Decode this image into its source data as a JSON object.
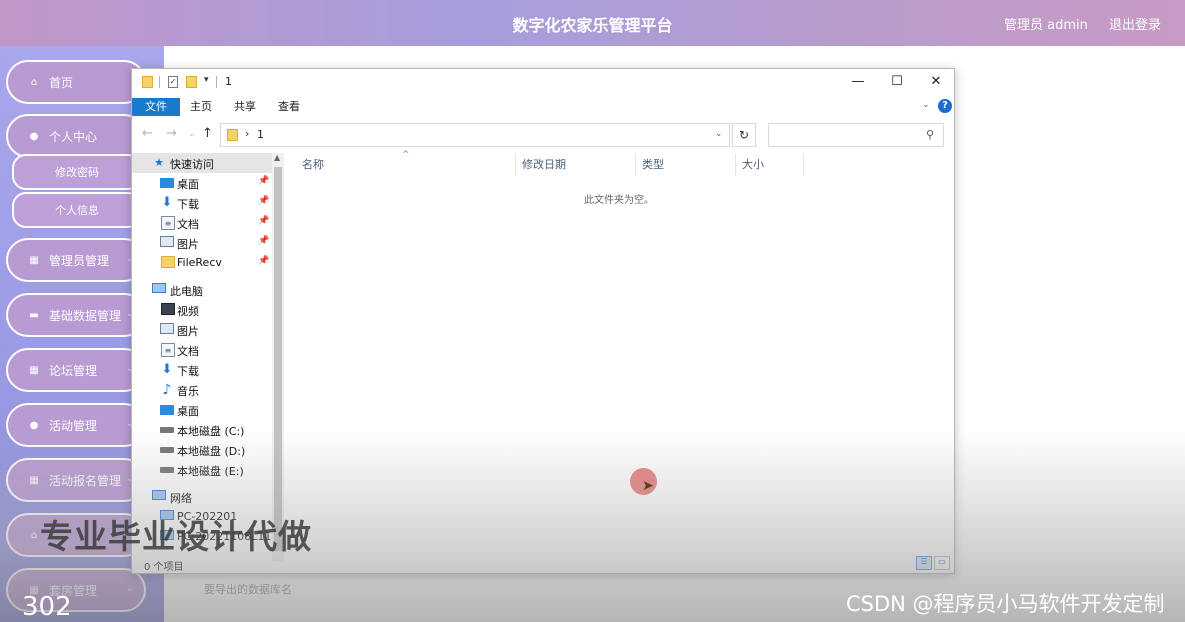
{
  "header": {
    "title": "数字化农家乐管理平台",
    "user": "管理员 admin",
    "logout": "退出登录"
  },
  "sidebar": {
    "items": [
      {
        "label": "首页",
        "icon": "home-icon"
      },
      {
        "label": "个人中心",
        "icon": "user-icon"
      },
      {
        "label": "管理员管理",
        "icon": "grid-icon"
      },
      {
        "label": "基础数据管理",
        "icon": "briefcase-icon"
      },
      {
        "label": "论坛管理",
        "icon": "grid-icon"
      },
      {
        "label": "活动管理",
        "icon": "user-icon"
      },
      {
        "label": "活动报名管理",
        "icon": "grid-icon"
      },
      {
        "label": "",
        "icon": "home-icon"
      },
      {
        "label": "套房管理",
        "icon": "grid-icon"
      }
    ],
    "subitems": [
      "修改密码",
      "个人信息"
    ]
  },
  "explorer": {
    "title": "1",
    "ribbon_tabs": [
      "文件",
      "主页",
      "共享",
      "查看"
    ],
    "address": "1",
    "search_placeholder": "",
    "nav": {
      "quick_access": "快速访问",
      "quick_items": [
        "桌面",
        "下载",
        "文档",
        "图片",
        "FileRecv"
      ],
      "this_pc": "此电脑",
      "pc_items": [
        "视频",
        "图片",
        "文档",
        "下载",
        "音乐",
        "桌面",
        "本地磁盘 (C:)",
        "本地磁盘 (D:)",
        "本地磁盘 (E:)"
      ],
      "network": "网络",
      "network_items": [
        "PC-202201",
        "PC-20221108L115"
      ]
    },
    "columns": [
      "名称",
      "修改日期",
      "类型",
      "大小"
    ],
    "empty_text": "此文件夹为空。",
    "status": "0 个项目"
  },
  "below_window_text": "要导出的数据库名",
  "watermarks": {
    "promo": "专业毕业设计代做",
    "number": "302",
    "csdn": "CSDN @程序员小马软件开发定制"
  },
  "colors": {
    "header_gradient_mid": "#a79ddc",
    "sidebar_bg": "#9c9ce6",
    "nav_button": "#b99bd4",
    "ribbon_active": "#1979ca"
  }
}
